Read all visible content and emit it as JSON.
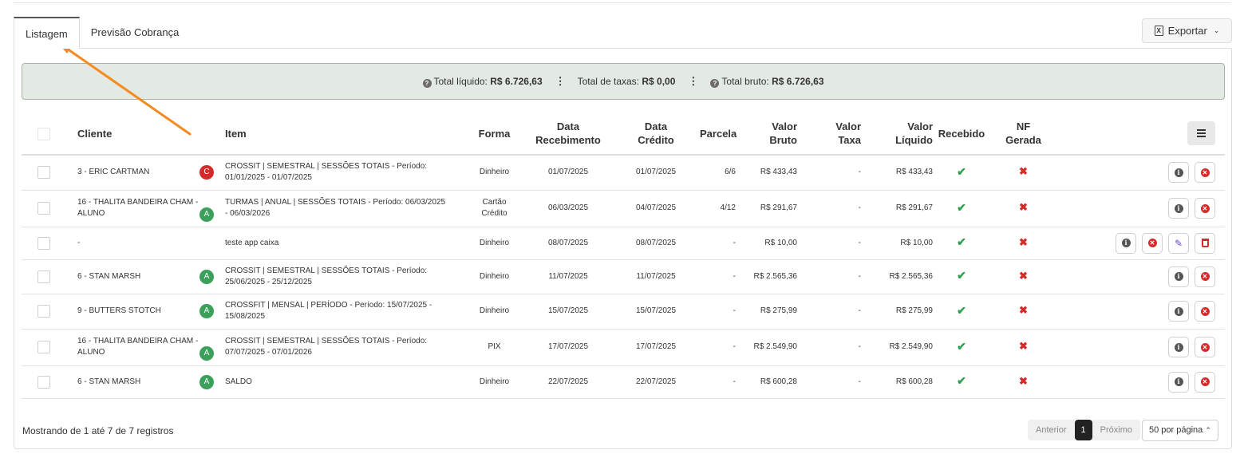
{
  "tabs": [
    {
      "label": "Listagem",
      "active": true
    },
    {
      "label": "Previsão Cobrança",
      "active": false
    }
  ],
  "export_label": "Exportar",
  "export_icon": "file-excel-icon",
  "summary": {
    "liquido_label": "Total líquido:",
    "liquido_value": "R$ 6.726,63",
    "taxas_label": "Total de taxas:",
    "taxas_value": "R$ 0,00",
    "bruto_label": "Total bruto:",
    "bruto_value": "R$ 6.726,63"
  },
  "columns": {
    "cliente": "Cliente",
    "item": "Item",
    "forma": "Forma",
    "data_recebimento": "Data Recebimento",
    "data_credito": "Data Crédito",
    "parcela": "Parcela",
    "valor_bruto": "Valor Bruto",
    "valor_taxa": "Valor Taxa",
    "valor_liquido": "Valor Líquido",
    "recebido": "Recebido",
    "nf_gerada": "NF Gerada"
  },
  "rows": [
    {
      "cliente": "3 - ERIC CARTMAN",
      "badge": "C",
      "item": "CROSSIT | SEMESTRAL | SESSÕES TOTAIS - Período: 01/01/2025 - 01/07/2025",
      "forma": "Dinheiro",
      "data_recebimento": "01/07/2025",
      "data_credito": "01/07/2025",
      "parcela": "6/6",
      "valor_bruto": "R$ 433,43",
      "valor_taxa": "-",
      "valor_liquido": "R$ 433,43",
      "extra_actions": false
    },
    {
      "cliente": "16 - THALITA BANDEIRA CHAM - ALUNO",
      "badge": "A",
      "item": "TURMAS | ANUAL | SESSÕES TOTAIS - Período: 06/03/2025 - 06/03/2026",
      "forma": "Cartão Crédito",
      "data_recebimento": "06/03/2025",
      "data_credito": "04/07/2025",
      "parcela": "4/12",
      "valor_bruto": "R$ 291,67",
      "valor_taxa": "-",
      "valor_liquido": "R$ 291,67",
      "extra_actions": false
    },
    {
      "cliente": "-",
      "badge": "",
      "item": "teste app caixa",
      "forma": "Dinheiro",
      "data_recebimento": "08/07/2025",
      "data_credito": "08/07/2025",
      "parcela": "-",
      "valor_bruto": "R$ 10,00",
      "valor_taxa": "-",
      "valor_liquido": "R$ 10,00",
      "extra_actions": true
    },
    {
      "cliente": "6 - STAN MARSH",
      "badge": "A",
      "item": "CROSSIT | SEMESTRAL | SESSÕES TOTAIS - Período: 25/06/2025 - 25/12/2025",
      "forma": "Dinheiro",
      "data_recebimento": "11/07/2025",
      "data_credito": "11/07/2025",
      "parcela": "-",
      "valor_bruto": "R$ 2.565,36",
      "valor_taxa": "-",
      "valor_liquido": "R$ 2.565,36",
      "extra_actions": false
    },
    {
      "cliente": "9 - BUTTERS STOTCH",
      "badge": "A",
      "item": "CROSSFIT | MENSAL | PERÍODO - Período: 15/07/2025 - 15/08/2025",
      "forma": "Dinheiro",
      "data_recebimento": "15/07/2025",
      "data_credito": "15/07/2025",
      "parcela": "-",
      "valor_bruto": "R$ 275,99",
      "valor_taxa": "-",
      "valor_liquido": "R$ 275,99",
      "extra_actions": false
    },
    {
      "cliente": "16 - THALITA BANDEIRA CHAM - ALUNO",
      "badge": "A",
      "item": "CROSSIT | SEMESTRAL | SESSÕES TOTAIS - Período: 07/07/2025 - 07/01/2026",
      "forma": "PIX",
      "data_recebimento": "17/07/2025",
      "data_credito": "17/07/2025",
      "parcela": "-",
      "valor_bruto": "R$ 2.549,90",
      "valor_taxa": "-",
      "valor_liquido": "R$ 2.549,90",
      "extra_actions": false
    },
    {
      "cliente": "6 - STAN MARSH",
      "badge": "A",
      "item": "SALDO",
      "forma": "Dinheiro",
      "data_recebimento": "22/07/2025",
      "data_credito": "22/07/2025",
      "parcela": "-",
      "valor_bruto": "R$ 600,28",
      "valor_taxa": "-",
      "valor_liquido": "R$ 600,28",
      "extra_actions": false
    }
  ],
  "footer": {
    "showing": "Mostrando de 1 até 7 de 7 registros",
    "prev": "Anterior",
    "current_page": "1",
    "next": "Próximo",
    "per_page": "50 por página"
  },
  "colors": {
    "annotation_arrow": "#f58a1f",
    "summary_bg": "#e3e9e3",
    "received_check": "#2ea04f",
    "nf_cross": "#d42a2a"
  }
}
